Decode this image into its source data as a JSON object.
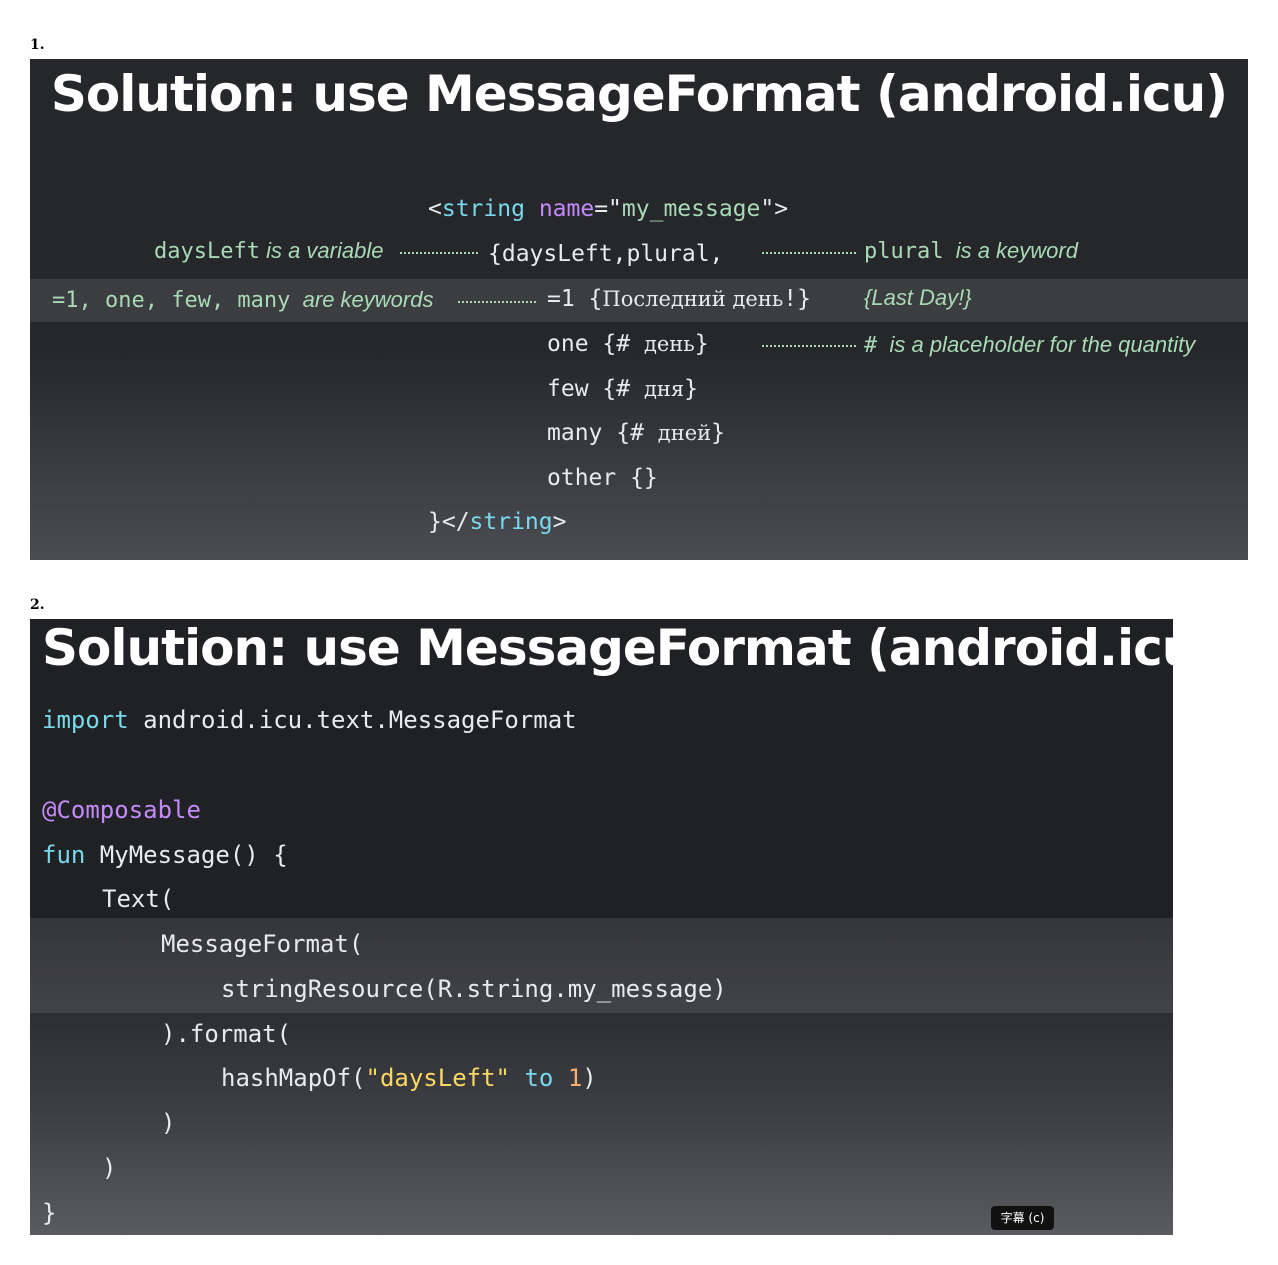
{
  "labels": {
    "first": "1.",
    "second": "2."
  },
  "slide1": {
    "title": "Solution: use MessageFormat (android.icu)",
    "line1": {
      "lt": "<",
      "tag": "string",
      "attr": "name",
      "eq": "=\"",
      "val": "my_message",
      "end": "\">"
    },
    "line2": {
      "code": "{daysLeft,plural,",
      "note_var": "daysLeft",
      "note_text": " is a variable",
      "right_kw": "plural",
      "right_text": "  is a keyword"
    },
    "line3": {
      "left_kw": "=1, one, few, many",
      "left_text": "  are keywords",
      "code": "=1 {",
      "cyr": "Последний день",
      "code_end": "!}",
      "right": "{Last Day!}"
    },
    "line4": {
      "code": "one {# ",
      "cyr": "день",
      "end": "}",
      "right_hash": "#",
      "right_text": "  is a placeholder for the quantity"
    },
    "line5": {
      "code": "few {# ",
      "cyr": "дня",
      "end": "}"
    },
    "line6": {
      "code": "many {# ",
      "cyr": "дней",
      "end": "}"
    },
    "line7": {
      "code": "other {}"
    },
    "line8": {
      "pre": "}</",
      "tag": "string",
      "post": ">"
    }
  },
  "slide2": {
    "title": "Solution: use MessageFormat (android.icu)",
    "import_kw": "import",
    "import_rest": " android.icu.text.MessageFormat",
    "annotation": "@Composable",
    "fun_kw": "fun",
    "fun_rest": " MyMessage() {",
    "text_open": "Text(",
    "mf_open": "MessageFormat(",
    "string_resource": "stringResource(R.string.my_message)",
    "format_call": ").format(",
    "hashmap_pre": "hashMapOf(",
    "hashmap_str": "\"daysLeft\"",
    "hashmap_to": "to",
    "hashmap_num": "1",
    "hashmap_post": ")",
    "close1": ")",
    "close2": ")",
    "close3": "}"
  },
  "badge": "字幕 (c)",
  "colors": {
    "keyword": "#78d9ec",
    "annotation": "#c58af9",
    "note": "#a8dab5",
    "string": "#fdd663",
    "number": "#fcad70"
  }
}
